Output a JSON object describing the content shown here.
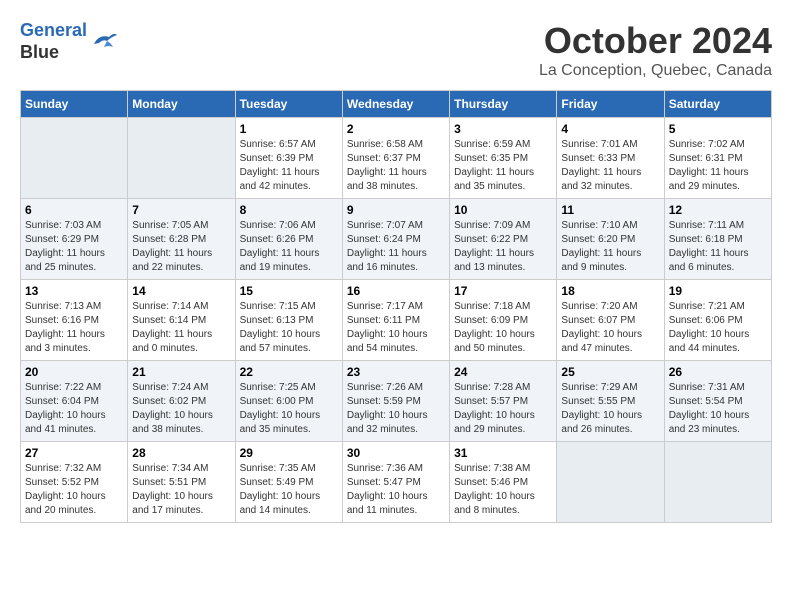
{
  "logo": {
    "line1": "General",
    "line2": "Blue"
  },
  "title": "October 2024",
  "location": "La Conception, Quebec, Canada",
  "days_of_week": [
    "Sunday",
    "Monday",
    "Tuesday",
    "Wednesday",
    "Thursday",
    "Friday",
    "Saturday"
  ],
  "weeks": [
    [
      {
        "day": "",
        "empty": true
      },
      {
        "day": "",
        "empty": true
      },
      {
        "day": "1",
        "sunrise": "6:57 AM",
        "sunset": "6:39 PM",
        "daylight": "11 hours and 42 minutes."
      },
      {
        "day": "2",
        "sunrise": "6:58 AM",
        "sunset": "6:37 PM",
        "daylight": "11 hours and 38 minutes."
      },
      {
        "day": "3",
        "sunrise": "6:59 AM",
        "sunset": "6:35 PM",
        "daylight": "11 hours and 35 minutes."
      },
      {
        "day": "4",
        "sunrise": "7:01 AM",
        "sunset": "6:33 PM",
        "daylight": "11 hours and 32 minutes."
      },
      {
        "day": "5",
        "sunrise": "7:02 AM",
        "sunset": "6:31 PM",
        "daylight": "11 hours and 29 minutes."
      }
    ],
    [
      {
        "day": "6",
        "sunrise": "7:03 AM",
        "sunset": "6:29 PM",
        "daylight": "11 hours and 25 minutes."
      },
      {
        "day": "7",
        "sunrise": "7:05 AM",
        "sunset": "6:28 PM",
        "daylight": "11 hours and 22 minutes."
      },
      {
        "day": "8",
        "sunrise": "7:06 AM",
        "sunset": "6:26 PM",
        "daylight": "11 hours and 19 minutes."
      },
      {
        "day": "9",
        "sunrise": "7:07 AM",
        "sunset": "6:24 PM",
        "daylight": "11 hours and 16 minutes."
      },
      {
        "day": "10",
        "sunrise": "7:09 AM",
        "sunset": "6:22 PM",
        "daylight": "11 hours and 13 minutes."
      },
      {
        "day": "11",
        "sunrise": "7:10 AM",
        "sunset": "6:20 PM",
        "daylight": "11 hours and 9 minutes."
      },
      {
        "day": "12",
        "sunrise": "7:11 AM",
        "sunset": "6:18 PM",
        "daylight": "11 hours and 6 minutes."
      }
    ],
    [
      {
        "day": "13",
        "sunrise": "7:13 AM",
        "sunset": "6:16 PM",
        "daylight": "11 hours and 3 minutes."
      },
      {
        "day": "14",
        "sunrise": "7:14 AM",
        "sunset": "6:14 PM",
        "daylight": "11 hours and 0 minutes."
      },
      {
        "day": "15",
        "sunrise": "7:15 AM",
        "sunset": "6:13 PM",
        "daylight": "10 hours and 57 minutes."
      },
      {
        "day": "16",
        "sunrise": "7:17 AM",
        "sunset": "6:11 PM",
        "daylight": "10 hours and 54 minutes."
      },
      {
        "day": "17",
        "sunrise": "7:18 AM",
        "sunset": "6:09 PM",
        "daylight": "10 hours and 50 minutes."
      },
      {
        "day": "18",
        "sunrise": "7:20 AM",
        "sunset": "6:07 PM",
        "daylight": "10 hours and 47 minutes."
      },
      {
        "day": "19",
        "sunrise": "7:21 AM",
        "sunset": "6:06 PM",
        "daylight": "10 hours and 44 minutes."
      }
    ],
    [
      {
        "day": "20",
        "sunrise": "7:22 AM",
        "sunset": "6:04 PM",
        "daylight": "10 hours and 41 minutes."
      },
      {
        "day": "21",
        "sunrise": "7:24 AM",
        "sunset": "6:02 PM",
        "daylight": "10 hours and 38 minutes."
      },
      {
        "day": "22",
        "sunrise": "7:25 AM",
        "sunset": "6:00 PM",
        "daylight": "10 hours and 35 minutes."
      },
      {
        "day": "23",
        "sunrise": "7:26 AM",
        "sunset": "5:59 PM",
        "daylight": "10 hours and 32 minutes."
      },
      {
        "day": "24",
        "sunrise": "7:28 AM",
        "sunset": "5:57 PM",
        "daylight": "10 hours and 29 minutes."
      },
      {
        "day": "25",
        "sunrise": "7:29 AM",
        "sunset": "5:55 PM",
        "daylight": "10 hours and 26 minutes."
      },
      {
        "day": "26",
        "sunrise": "7:31 AM",
        "sunset": "5:54 PM",
        "daylight": "10 hours and 23 minutes."
      }
    ],
    [
      {
        "day": "27",
        "sunrise": "7:32 AM",
        "sunset": "5:52 PM",
        "daylight": "10 hours and 20 minutes."
      },
      {
        "day": "28",
        "sunrise": "7:34 AM",
        "sunset": "5:51 PM",
        "daylight": "10 hours and 17 minutes."
      },
      {
        "day": "29",
        "sunrise": "7:35 AM",
        "sunset": "5:49 PM",
        "daylight": "10 hours and 14 minutes."
      },
      {
        "day": "30",
        "sunrise": "7:36 AM",
        "sunset": "5:47 PM",
        "daylight": "10 hours and 11 minutes."
      },
      {
        "day": "31",
        "sunrise": "7:38 AM",
        "sunset": "5:46 PM",
        "daylight": "10 hours and 8 minutes."
      },
      {
        "day": "",
        "empty": true
      },
      {
        "day": "",
        "empty": true
      }
    ]
  ],
  "labels": {
    "sunrise": "Sunrise:",
    "sunset": "Sunset:",
    "daylight": "Daylight:"
  }
}
